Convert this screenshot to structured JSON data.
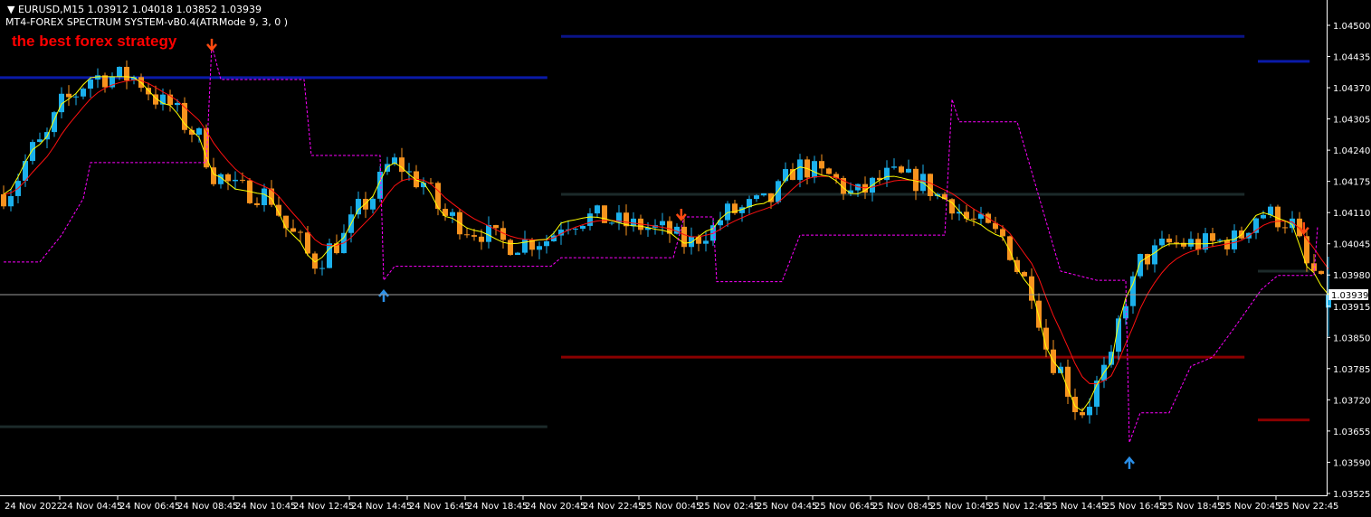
{
  "header": {
    "symbol_line": "▼ EURUSD,M15  1.03912 1.04018 1.03852 1.03939",
    "indicator_line": "MT4-FOREX SPECTRUM SYSTEM-vB0.4(ATRMode 9, 3, 0 )",
    "tagline": "the best forex strategy"
  },
  "colors": {
    "bull": "#1bb0ec",
    "bear": "#f7931e",
    "fast_ma": "#ffff00",
    "slow_ma": "#ff1010",
    "trail": "#ff00ff",
    "bg": "#000000"
  },
  "chart_data": {
    "type": "candlestick",
    "title": "EURUSD,M15",
    "last_bar": {
      "open": 1.03912,
      "high": 1.04018,
      "low": 1.03852,
      "close": 1.03939
    },
    "current_price": "1.03939",
    "bars": 184,
    "ylim": [
      1.03525,
      1.045
    ],
    "y_ticks": [
      "1.04500",
      "1.04435",
      "1.04370",
      "1.04305",
      "1.04240",
      "1.04175",
      "1.04110",
      "1.04045",
      "1.03980",
      "1.03915",
      "1.03850",
      "1.03785",
      "1.03720",
      "1.03655",
      "1.03590",
      "1.03525"
    ],
    "x_ticks": [
      "24 Nov 2022",
      "24 Nov 04:45",
      "24 Nov 06:45",
      "24 Nov 08:45",
      "24 Nov 10:45",
      "24 Nov 12:45",
      "24 Nov 14:45",
      "24 Nov 16:45",
      "24 Nov 18:45",
      "24 Nov 20:45",
      "24 Nov 22:45",
      "25 Nov 00:45",
      "25 Nov 02:45",
      "25 Nov 04:45",
      "25 Nov 06:45",
      "25 Nov 08:45",
      "25 Nov 10:45",
      "25 Nov 12:45",
      "25 Nov 14:45",
      "25 Nov 16:45",
      "25 Nov 18:45",
      "25 Nov 20:45",
      "25 Nov 22:45"
    ],
    "close_path": [
      [
        0,
        1.04148
      ],
      [
        5,
        1.04252
      ],
      [
        8.75,
        1.04346
      ],
      [
        12.5,
        1.04393
      ],
      [
        17.5,
        1.04393
      ],
      [
        22.5,
        1.04336
      ],
      [
        26.25,
        1.0428
      ],
      [
        29.4,
        1.04186
      ],
      [
        32.5,
        1.04157
      ],
      [
        36.25,
        1.04148
      ],
      [
        40,
        1.04063
      ],
      [
        43,
        1.04007
      ],
      [
        46,
        1.04045
      ],
      [
        50,
        1.04129
      ],
      [
        53.75,
        1.04214
      ],
      [
        57.5,
        1.04176
      ],
      [
        61.25,
        1.04101
      ],
      [
        65,
        1.04073
      ],
      [
        70,
        1.04045
      ],
      [
        75,
        1.04054
      ],
      [
        77.5,
        1.04092
      ],
      [
        81.25,
        1.04101
      ],
      [
        87.5,
        1.04082
      ],
      [
        91.25,
        1.04073
      ],
      [
        94.4,
        1.04045
      ],
      [
        97.5,
        1.04073
      ],
      [
        100,
        1.0411
      ],
      [
        105,
        1.04129
      ],
      [
        110,
        1.04205
      ],
      [
        113.75,
        1.04186
      ],
      [
        117.5,
        1.04148
      ],
      [
        122.5,
        1.04186
      ],
      [
        126.25,
        1.04176
      ],
      [
        130,
        1.04139
      ],
      [
        133.75,
        1.04092
      ],
      [
        137.5,
        1.04063
      ],
      [
        141.25,
        1.03969
      ],
      [
        145,
        1.038
      ],
      [
        148.75,
        1.03696
      ],
      [
        152.5,
        1.03781
      ],
      [
        155,
        1.03932
      ],
      [
        157.5,
        1.04016
      ],
      [
        161.25,
        1.04045
      ],
      [
        166.25,
        1.04045
      ],
      [
        170,
        1.04054
      ],
      [
        173.75,
        1.0411
      ],
      [
        177.5,
        1.04092
      ],
      [
        180.6,
        1.03988
      ],
      [
        183,
        1.03939
      ]
    ],
    "trail_stop": [
      [
        0,
        1.04007
      ],
      [
        5,
        1.04007
      ],
      [
        8,
        1.04063
      ],
      [
        11,
        1.04139
      ],
      [
        12,
        1.04214
      ],
      [
        28,
        1.04214
      ],
      [
        28.75,
        1.04459
      ],
      [
        30,
        1.04387
      ],
      [
        41.5,
        1.04387
      ],
      [
        42.5,
        1.04229
      ],
      [
        52,
        1.04229
      ],
      [
        52.5,
        1.03969
      ],
      [
        54,
        1.03998
      ],
      [
        75.6,
        1.03998
      ],
      [
        77,
        1.04016
      ],
      [
        92.5,
        1.04016
      ],
      [
        94,
        1.04101
      ],
      [
        98,
        1.04101
      ],
      [
        98.5,
        1.03966
      ],
      [
        107.5,
        1.03966
      ],
      [
        110,
        1.04063
      ],
      [
        130,
        1.04063
      ],
      [
        131,
        1.04346
      ],
      [
        132,
        1.04299
      ],
      [
        140,
        1.04299
      ],
      [
        146,
        1.03988
      ],
      [
        151,
        1.03969
      ],
      [
        155,
        1.03969
      ],
      [
        155.5,
        1.03631
      ],
      [
        157,
        1.03693
      ],
      [
        161,
        1.03693
      ],
      [
        164,
        1.0379
      ],
      [
        167,
        1.03809
      ],
      [
        170,
        1.0387
      ],
      [
        173.75,
        1.0395
      ],
      [
        176,
        1.03979
      ],
      [
        181,
        1.03979
      ],
      [
        181.5,
        1.04082
      ]
    ],
    "levels": [
      {
        "name": "resistance",
        "from": 0,
        "to": 75.6,
        "price": 1.04391,
        "color": "#0a1aa8"
      },
      {
        "name": "support",
        "from": 0,
        "to": 75.6,
        "price": 1.03664,
        "color": "#1c2a2a"
      },
      {
        "name": "resistance",
        "from": 77.5,
        "to": 171.9,
        "price": 1.04477,
        "color": "#0a1488"
      },
      {
        "name": "pivot",
        "from": 77.5,
        "to": 171.9,
        "price": 1.04148,
        "color": "#1c2a2a"
      },
      {
        "name": "support",
        "from": 77.5,
        "to": 171.9,
        "price": 1.03809,
        "color": "#8a0000"
      },
      {
        "name": "resistance",
        "from": 173.75,
        "to": 180.9,
        "price": 1.04425,
        "color": "#0a1aa8"
      },
      {
        "name": "pivot",
        "from": 173.75,
        "to": 180.9,
        "price": 1.03988,
        "color": "#1c2a2a"
      },
      {
        "name": "support",
        "from": 173.75,
        "to": 180.9,
        "price": 1.03678,
        "color": "#8a0000"
      }
    ],
    "signals": [
      {
        "type": "sell",
        "bar": 28.75,
        "price": 1.04455
      },
      {
        "type": "buy",
        "bar": 52.5,
        "price": 1.03941
      },
      {
        "type": "sell",
        "bar": 93.6,
        "price": 1.04101
      },
      {
        "type": "buy",
        "bar": 155.5,
        "price": 1.03593
      },
      {
        "type": "sell",
        "bar": 179.6,
        "price": 1.04073
      }
    ]
  }
}
